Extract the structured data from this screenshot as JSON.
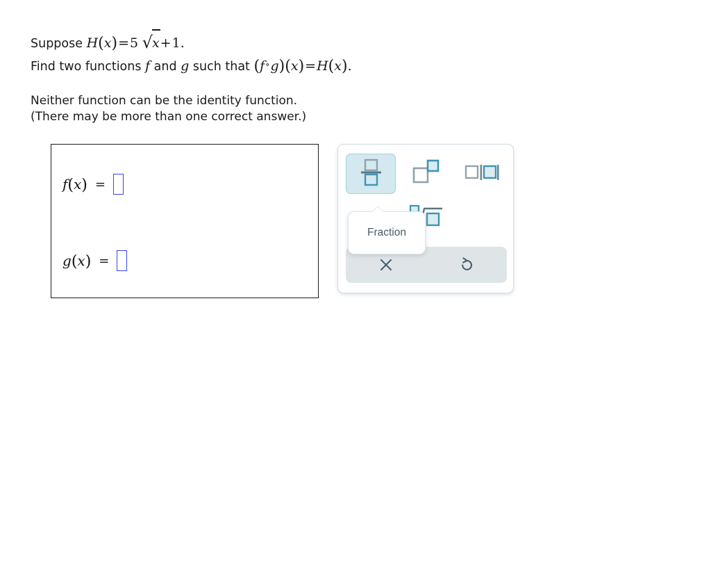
{
  "problem": {
    "line1": {
      "prefix": "Suppose ",
      "fn_name": "H",
      "arg": "x",
      "equals": "=",
      "coefficient": "5",
      "radicand": "x",
      "plus": "+",
      "constant": "1",
      "period": "."
    },
    "line2": {
      "prefix": "Find two functions ",
      "f": "f",
      "conjunction": " and ",
      "g": "g",
      "middle": " such that ",
      "comp_f": "f",
      "comp_ring": "∘",
      "comp_g": "g",
      "comp_arg": "x",
      "equals": "=",
      "rhs_fn": "H",
      "rhs_arg": "x",
      "period": "."
    },
    "note1": "Neither function can be the identity function.",
    "note2": "(There may be more than one correct answer.)"
  },
  "answer_box": {
    "rows": [
      {
        "name": "f",
        "label_fn": "f",
        "label_arg": "x",
        "equals": "=",
        "value": "",
        "placeholder": ""
      },
      {
        "name": "g",
        "label_fn": "g",
        "label_arg": "x",
        "equals": "=",
        "value": "",
        "placeholder": ""
      }
    ]
  },
  "palette": {
    "buttons": [
      {
        "id": "fraction",
        "icon": "fraction-icon",
        "label": "Fraction",
        "selected": true
      },
      {
        "id": "exponent",
        "icon": "exponent-icon",
        "label": "Exponent",
        "selected": false
      },
      {
        "id": "absolute-value",
        "icon": "absolute-value-icon",
        "label": "Absolute value",
        "selected": false
      },
      {
        "id": "nth-root",
        "icon": "nth-root-icon",
        "label": "Root",
        "selected": false
      }
    ],
    "actions": [
      {
        "id": "clear",
        "icon": "close-icon",
        "glyph": "×",
        "label": "Clear"
      },
      {
        "id": "undo",
        "icon": "undo-icon",
        "glyph": "↺",
        "label": "Undo"
      }
    ],
    "tooltip": {
      "text": "Fraction",
      "for": "fraction"
    }
  },
  "colors": {
    "accent_teal": "#3f95b4",
    "icon_gray_blue": "#8fa3ad",
    "teal_fill": "#daecf2",
    "selected_bg": "#d3e8ef",
    "input_blue": "#3b45e8",
    "action_bar_bg": "#dfe5e7",
    "panel_border": "#d3dde2",
    "text": "#1a1a1a"
  }
}
